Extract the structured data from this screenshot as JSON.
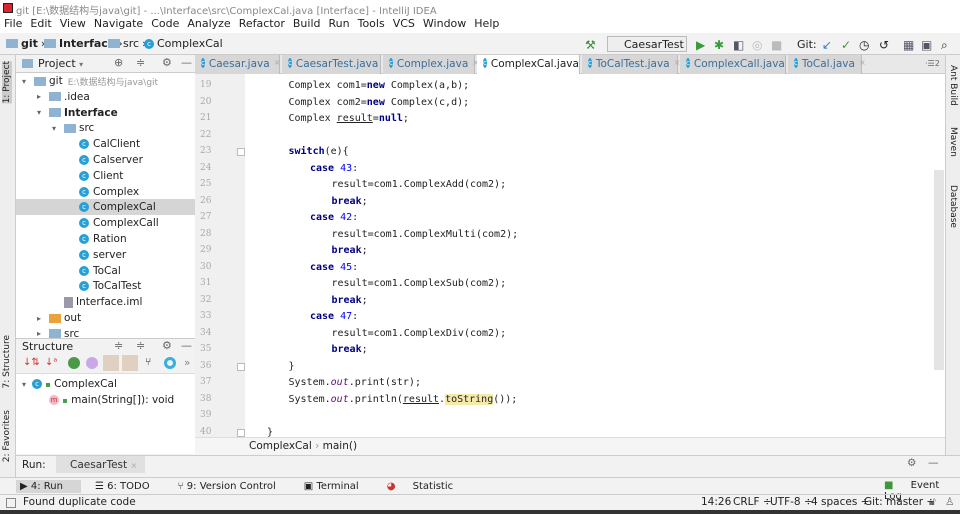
{
  "window": {
    "title": "git [E:\\数据结构与java\\git] - ...\\Interface\\src\\ComplexCal.java [Interface] - IntelliJ IDEA"
  },
  "menu": [
    "File",
    "Edit",
    "View",
    "Navigate",
    "Code",
    "Analyze",
    "Refactor",
    "Build",
    "Run",
    "Tools",
    "VCS",
    "Window",
    "Help"
  ],
  "breadcrumb": [
    "git",
    "Interface",
    "src",
    "ComplexCal"
  ],
  "toolbar": {
    "run_config": "CaesarTest",
    "git_label": "Git:"
  },
  "project": {
    "header": "Project",
    "tree": [
      {
        "label": "git",
        "hint": "E:\\数据结构与java\\git",
        "depth": 0,
        "type": "folder",
        "open": true
      },
      {
        "label": ".idea",
        "depth": 1,
        "type": "folder",
        "open": false
      },
      {
        "label": "Interface",
        "depth": 1,
        "type": "folder",
        "open": true,
        "bold": true
      },
      {
        "label": "src",
        "depth": 2,
        "type": "folder",
        "open": true
      },
      {
        "label": "CalClient",
        "depth": 3,
        "type": "class"
      },
      {
        "label": "Calserver",
        "depth": 3,
        "type": "class"
      },
      {
        "label": "Client",
        "depth": 3,
        "type": "class"
      },
      {
        "label": "Complex",
        "depth": 3,
        "type": "class"
      },
      {
        "label": "ComplexCal",
        "depth": 3,
        "type": "class",
        "selected": true
      },
      {
        "label": "ComplexCall",
        "depth": 3,
        "type": "class"
      },
      {
        "label": "Ration",
        "depth": 3,
        "type": "class"
      },
      {
        "label": "server",
        "depth": 3,
        "type": "class"
      },
      {
        "label": "ToCal",
        "depth": 3,
        "type": "class"
      },
      {
        "label": "ToCalTest",
        "depth": 3,
        "type": "class"
      },
      {
        "label": "Interface.iml",
        "depth": 2,
        "type": "file"
      },
      {
        "label": "out",
        "depth": 1,
        "type": "folder",
        "open": false,
        "color": "#e8a33d"
      },
      {
        "label": "src",
        "depth": 1,
        "type": "folder",
        "open": false
      }
    ]
  },
  "structure": {
    "header": "Structure",
    "class": "ComplexCal",
    "method": "main(String[]): void"
  },
  "left_stripe": [
    "1: Project",
    "7: Structure",
    "2: Favorites"
  ],
  "right_stripe": [
    "Ant Build",
    "Maven",
    "Database"
  ],
  "tabs": [
    {
      "label": "Caesar.java"
    },
    {
      "label": "CaesarTest.java"
    },
    {
      "label": "Complex.java"
    },
    {
      "label": "ComplexCal.java",
      "active": true
    },
    {
      "label": "ToCalTest.java"
    },
    {
      "label": "ComplexCall.java"
    },
    {
      "label": "ToCal.java"
    }
  ],
  "tab_overflow": "2",
  "code": [
    {
      "n": "19",
      "ind": 1,
      "t": [
        [
          "Complex com1=",
          ""
        ],
        [
          "new",
          "kw"
        ],
        [
          " Complex(a,b);",
          ""
        ]
      ]
    },
    {
      "n": "20",
      "ind": 1,
      "t": [
        [
          "Complex com2=",
          ""
        ],
        [
          "new",
          "kw"
        ],
        [
          " Complex(c,d);",
          ""
        ]
      ]
    },
    {
      "n": "21",
      "ind": 1,
      "t": [
        [
          "Complex ",
          ""
        ],
        [
          "result",
          "ul"
        ],
        [
          "=",
          ""
        ],
        [
          "null",
          "kw"
        ],
        [
          ";",
          ""
        ]
      ]
    },
    {
      "n": "22",
      "ind": 1,
      "t": []
    },
    {
      "n": "23",
      "ind": 1,
      "t": [
        [
          "switch",
          "kw"
        ],
        [
          "(e){",
          ""
        ]
      ]
    },
    {
      "n": "24",
      "ind": 2,
      "t": [
        [
          "case",
          "kw"
        ],
        [
          " ",
          ""
        ],
        [
          "43",
          "num"
        ],
        [
          ":",
          ""
        ]
      ]
    },
    {
      "n": "25",
      "ind": 3,
      "t": [
        [
          "result=com1.ComplexAdd(com2);",
          ""
        ]
      ]
    },
    {
      "n": "26",
      "ind": 3,
      "t": [
        [
          "break",
          "kw"
        ],
        [
          ";",
          ""
        ]
      ]
    },
    {
      "n": "27",
      "ind": 2,
      "t": [
        [
          "case",
          "kw"
        ],
        [
          " ",
          ""
        ],
        [
          "42",
          "num"
        ],
        [
          ":",
          ""
        ]
      ]
    },
    {
      "n": "28",
      "ind": 3,
      "t": [
        [
          "result=com1.ComplexMulti(com2);",
          ""
        ]
      ]
    },
    {
      "n": "29",
      "ind": 3,
      "t": [
        [
          "break",
          "kw"
        ],
        [
          ";",
          ""
        ]
      ]
    },
    {
      "n": "30",
      "ind": 2,
      "t": [
        [
          "case",
          "kw"
        ],
        [
          " ",
          ""
        ],
        [
          "45",
          "num"
        ],
        [
          ":",
          ""
        ]
      ]
    },
    {
      "n": "31",
      "ind": 3,
      "t": [
        [
          "result=com1.ComplexSub(com2);",
          ""
        ]
      ]
    },
    {
      "n": "32",
      "ind": 3,
      "t": [
        [
          "break",
          "kw"
        ],
        [
          ";",
          ""
        ]
      ]
    },
    {
      "n": "33",
      "ind": 2,
      "t": [
        [
          "case",
          "kw"
        ],
        [
          " ",
          ""
        ],
        [
          "47",
          "num"
        ],
        [
          ":",
          ""
        ]
      ]
    },
    {
      "n": "34",
      "ind": 3,
      "t": [
        [
          "result=com1.ComplexDiv(com2);",
          ""
        ]
      ]
    },
    {
      "n": "35",
      "ind": 3,
      "t": [
        [
          "break",
          "kw"
        ],
        [
          ";",
          ""
        ]
      ]
    },
    {
      "n": "36",
      "ind": 1,
      "t": [
        [
          "}",
          ""
        ]
      ]
    },
    {
      "n": "37",
      "ind": 1,
      "t": [
        [
          "System.",
          ""
        ],
        [
          "out",
          "st"
        ],
        [
          ".print(str);",
          ""
        ]
      ]
    },
    {
      "n": "38",
      "ind": 1,
      "t": [
        [
          "System.",
          ""
        ],
        [
          "out",
          "st"
        ],
        [
          ".println(",
          ""
        ],
        [
          "result",
          "ul"
        ],
        [
          ".",
          ""
        ],
        [
          "toString",
          "hl"
        ],
        [
          "());",
          ""
        ]
      ]
    },
    {
      "n": "39",
      "ind": 1,
      "t": []
    },
    {
      "n": "40",
      "ind": 0,
      "t": [
        [
          "}",
          ""
        ]
      ]
    }
  ],
  "editor_breadcrumb": [
    "ComplexCal",
    "main()"
  ],
  "run": {
    "label": "Run:",
    "config": "CaesarTest"
  },
  "tool_windows": [
    "4: Run",
    "6: TODO",
    "9: Version Control",
    "Terminal",
    "Statistic"
  ],
  "event_log": "Event Log",
  "status": {
    "message": "Found duplicate code",
    "position": "14:26",
    "line_sep": "CRLF",
    "encoding": "UTF-8",
    "indent": "4 spaces",
    "vcs": "Git: master"
  }
}
